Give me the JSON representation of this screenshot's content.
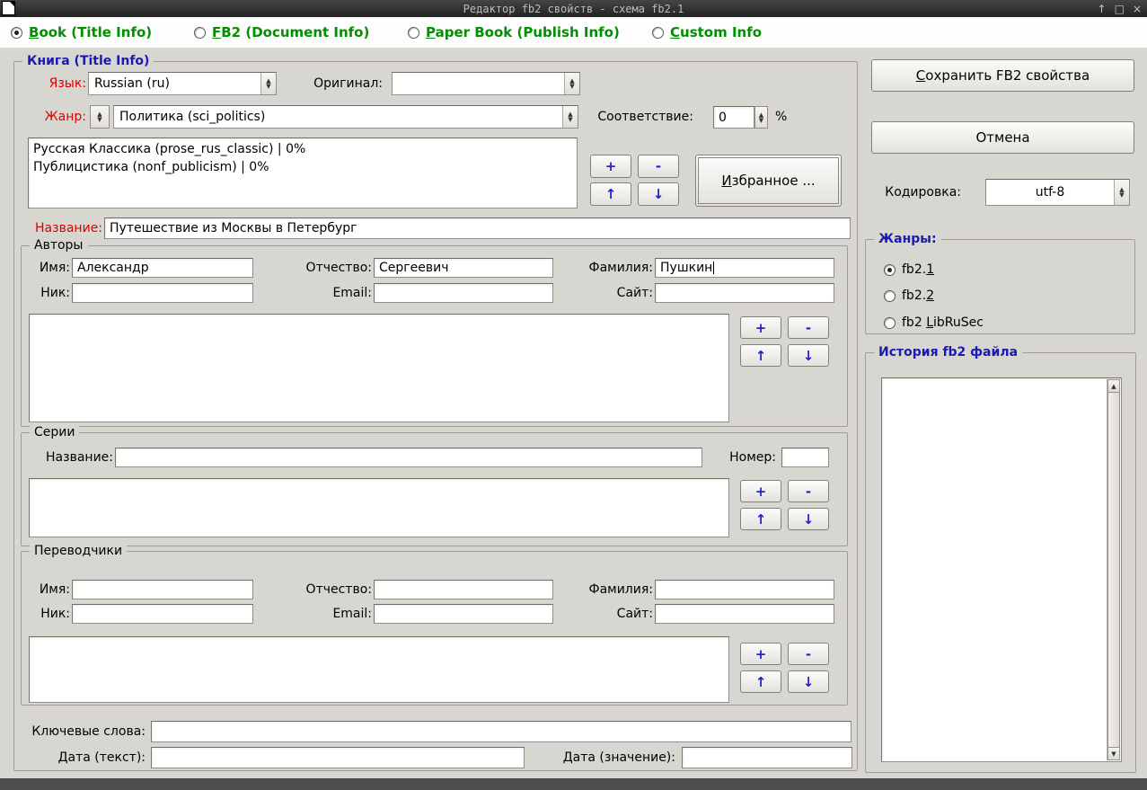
{
  "window": {
    "title": "Редактор fb2 свойств - схема fb2.1",
    "controls": {
      "shade": "↑",
      "maximize": "□",
      "close": "×"
    }
  },
  "icons": {
    "combo_up": "▲",
    "combo_down": "▼",
    "scroll_up": "▲",
    "scroll_down": "▼"
  },
  "tabs": [
    {
      "pre": "",
      "key": "B",
      "rest": "ook (Title Info)"
    },
    {
      "pre": "",
      "key": "F",
      "rest": "B2 (Document Info)"
    },
    {
      "pre": "",
      "key": "P",
      "rest": "aper Book (Publish Info)"
    },
    {
      "pre": "",
      "key": "C",
      "rest": "ustom Info"
    }
  ],
  "list_buttons": {
    "add": "+",
    "remove": "-",
    "up": "↑",
    "down": "↓"
  },
  "main": {
    "legend": "Книга (Title Info)",
    "language_label": "Язык:",
    "language_value": "Russian (ru)",
    "original_label": "Оригинал:",
    "original_value": "",
    "genre_label": "Жанр:",
    "genre_value": "Политика (sci_politics)",
    "match_label": "Соответствие:",
    "match_value": "0",
    "match_unit": "%",
    "genres": [
      "Русская Классика (prose_rus_classic) | 0%",
      "Публицистика (nonf_publicism) | 0%"
    ],
    "favorites": {
      "pre": "",
      "key": "И",
      "rest": "збранное ..."
    },
    "title_label": "Название:",
    "title_value": "Путешествие из Москвы в Петербург",
    "authors": {
      "legend": "Авторы",
      "name_label": "Имя:",
      "name_value": "Александр",
      "middle_label": "Отчество:",
      "middle_value": "Сергеевич",
      "last_label": "Фамилия:",
      "last_value": "Пушкин",
      "nick_label": "Ник:",
      "nick_value": "",
      "email_label": "Email:",
      "email_value": "",
      "site_label": "Сайт:",
      "site_value": ""
    },
    "series": {
      "legend": "Серии",
      "name_label": "Название:",
      "name_value": "",
      "number_label": "Номер:",
      "number_value": ""
    },
    "translators": {
      "legend": "Переводчики",
      "name_label": "Имя:",
      "name_value": "",
      "middle_label": "Отчество:",
      "middle_value": "",
      "last_label": "Фамилия:",
      "last_value": "",
      "nick_label": "Ник:",
      "nick_value": "",
      "email_label": "Email:",
      "email_value": "",
      "site_label": "Сайт:",
      "site_value": ""
    },
    "keywords_label": "Ключевые слова:",
    "keywords_value": "",
    "date_text_label": "Дата (текст):",
    "date_text_value": "",
    "date_value_label": "Дата (значение):",
    "date_value_value": ""
  },
  "side": {
    "save": {
      "pre": "",
      "key": "С",
      "rest": "охранить FB2 свойства"
    },
    "cancel": "Отмена",
    "encoding_label": "Кодировка:",
    "encoding_value": "utf-8",
    "schema": {
      "legend": "Жанры:",
      "options": [
        {
          "pre": "fb2.",
          "key": "1",
          "rest": ""
        },
        {
          "pre": "fb2.",
          "key": "2",
          "rest": ""
        },
        {
          "pre": "fb2 ",
          "key": "L",
          "rest": "ibRuSec"
        }
      ]
    },
    "history": {
      "legend": "История fb2 файла"
    }
  }
}
